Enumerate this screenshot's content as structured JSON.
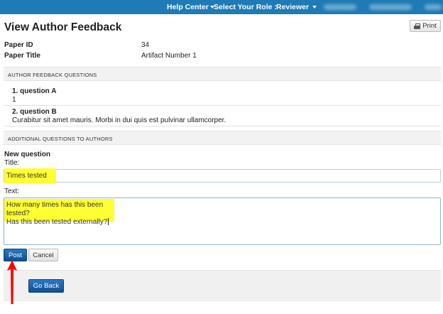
{
  "topnav": {
    "help_center": "Help Center",
    "select_role_label": "Select Your Role :",
    "role": "Reviewer"
  },
  "page": {
    "title": "View Author Feedback",
    "print_label": "Print"
  },
  "meta": {
    "paper_id_label": "Paper ID",
    "paper_id_value": "34",
    "paper_title_label": "Paper Title",
    "paper_title_value": "Artifact Number 1"
  },
  "author_feedback": {
    "header": "AUTHOR FEEDBACK QUESTIONS",
    "questions": [
      {
        "title": "1. question A",
        "answer": "1"
      },
      {
        "title": "2. question B",
        "answer": "Curabitur sit amet mauris. Morbi in dui quis est pulvinar ullamcorper."
      }
    ]
  },
  "additional_questions": {
    "header": "ADDITIONAL QUESTIONS TO AUTHORS",
    "new_question_label": "New question",
    "title_label": "Title:",
    "title_value": "Times tested",
    "text_label": "Text:",
    "text_lines": [
      "How many times has this been tested?",
      "Has this been tested externally?"
    ]
  },
  "actions": {
    "post_label": "Post",
    "cancel_label": "Cancel",
    "go_back_label": "Go Back"
  },
  "colors": {
    "topbar": "#1e7bb5",
    "primary_button": "#1560a8",
    "highlight": "#ffff33",
    "annotation_arrow": "#ff0000"
  }
}
